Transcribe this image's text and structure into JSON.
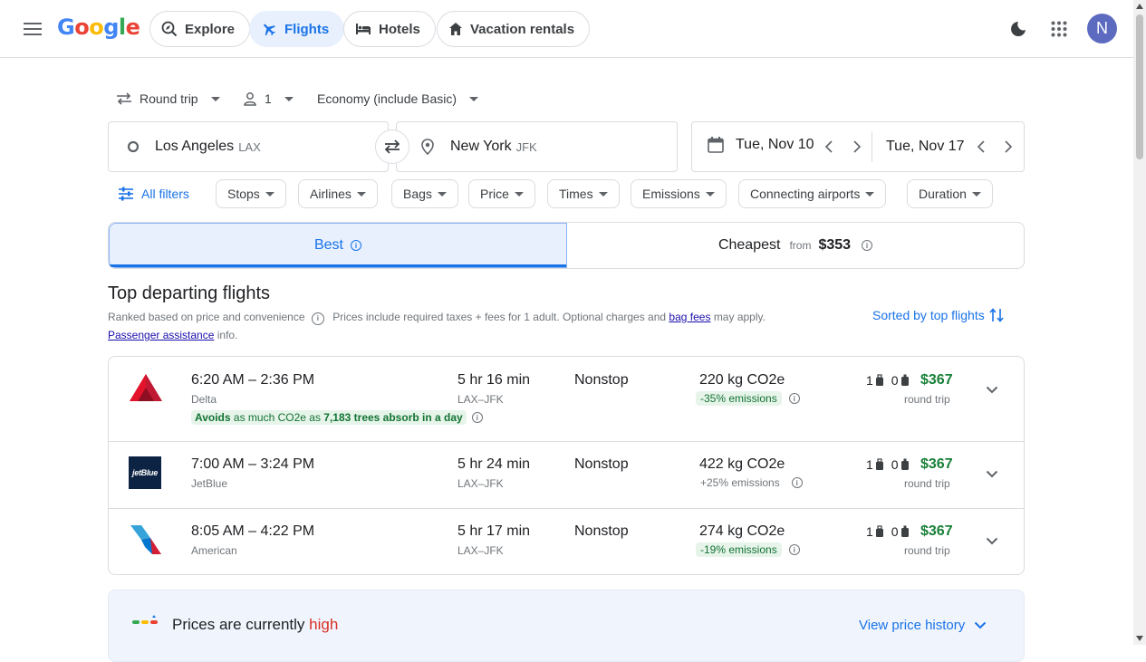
{
  "header": {
    "logo": "Google",
    "nav": [
      {
        "label": "Explore",
        "icon": "explore-icon"
      },
      {
        "label": "Flights",
        "icon": "flight-icon",
        "active": true
      },
      {
        "label": "Hotels",
        "icon": "bed-icon"
      },
      {
        "label": "Vacation rentals",
        "icon": "house-icon"
      }
    ],
    "avatar_letter": "N"
  },
  "search": {
    "trip_type": "Round trip",
    "passengers": "1",
    "cabin": "Economy (include Basic)",
    "origin": {
      "city": "Los Angeles",
      "code": "LAX"
    },
    "destination": {
      "city": "New York",
      "code": "JFK"
    },
    "depart_date": "Tue, Nov 10",
    "return_date": "Tue, Nov 17"
  },
  "filters": {
    "all_filters": "All filters",
    "chips": [
      "Stops",
      "Airlines",
      "Bags",
      "Price",
      "Times",
      "Emissions",
      "Connecting airports",
      "Duration"
    ]
  },
  "tabs": {
    "best": "Best",
    "cheapest": "Cheapest",
    "cheapest_from": "from",
    "cheapest_price": "$353"
  },
  "results_header": {
    "title": "Top departing flights",
    "ranked": "Ranked based on price and convenience",
    "prices_note": "Prices include required taxes + fees for 1 adult. Optional charges and",
    "bag_fees": "bag fees",
    "may_apply": "may apply.",
    "passenger_assistance": "Passenger assistance",
    "info": "info.",
    "sorted_by": "Sorted by top flights"
  },
  "flights": [
    {
      "times": "6:20 AM – 2:36 PM",
      "airline": "Delta",
      "avoid_prefix": "Avoids",
      "avoid_mid1": "as much CO2e as",
      "avoid_trees": "7,183 trees absorb in a day",
      "duration": "5 hr 16 min",
      "route": "LAX–JFK",
      "stops": "Nonstop",
      "co2": "220 kg CO2e",
      "emissions": "-35% emissions",
      "carry_on": "1",
      "checked": "0",
      "price": "$367",
      "price_type": "round trip"
    },
    {
      "times": "7:00 AM – 3:24 PM",
      "airline": "JetBlue",
      "duration": "5 hr 24 min",
      "route": "LAX–JFK",
      "stops": "Nonstop",
      "co2": "422 kg CO2e",
      "emissions": "+25% emissions",
      "carry_on": "1",
      "checked": "0",
      "price": "$367",
      "price_type": "round trip",
      "logo_text": "jetBlue"
    },
    {
      "times": "8:05 AM – 4:22 PM",
      "airline": "American",
      "duration": "5 hr 17 min",
      "route": "LAX–JFK",
      "stops": "Nonstop",
      "co2": "274 kg CO2e",
      "emissions": "-19% emissions",
      "carry_on": "1",
      "checked": "0",
      "price": "$367",
      "price_type": "round trip"
    }
  ],
  "price_insight": {
    "prefix": "Prices are currently",
    "level": "high",
    "link": "View price history"
  }
}
